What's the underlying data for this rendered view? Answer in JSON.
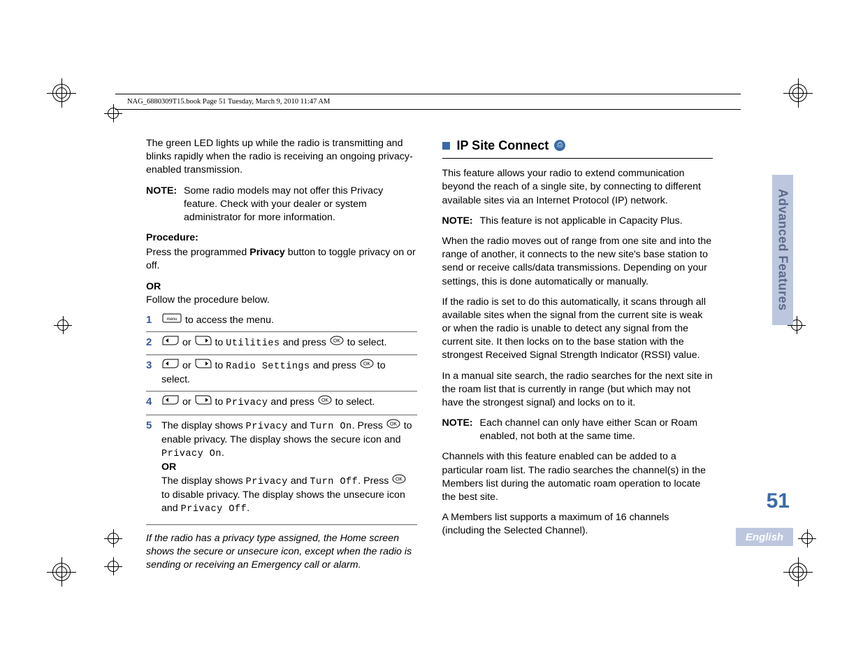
{
  "header": {
    "text": "NAG_6880309T15.book  Page 51  Tuesday, March 9, 2010  11:47 AM"
  },
  "left": {
    "p1": "The green LED lights up while the radio is transmitting and blinks rapidly when the radio is receiving an ongoing privacy-enabled transmission.",
    "note1_label": "NOTE:",
    "note1_text": "Some radio models may not offer this Privacy feature. Check with your dealer or system administrator for more information.",
    "procedure_label": "Procedure:",
    "procedure_p_a": "Press the programmed ",
    "procedure_p_b": "Privacy",
    "procedure_p_c": " button to toggle privacy on or off.",
    "or": "OR",
    "follow": "Follow the procedure below.",
    "step1": " to access the menu.",
    "step2_pre": " or ",
    "step2_to": " to ",
    "step2_target": "Utilities",
    "step2_post": " and press ",
    "step2_end": " to select.",
    "step3_target": "Radio Settings",
    "step4_target": "Privacy",
    "step5_a": "The display shows ",
    "step5_b": "Privacy",
    "step5_c": " and ",
    "step5_d": "Turn On",
    "step5_e": ". Press ",
    "step5_f": " to enable privacy. The display shows the secure icon and ",
    "step5_g": "Privacy On",
    "step5_h": ".",
    "step5_or": "OR",
    "step5_i": "The display shows ",
    "step5_j": "Privacy",
    "step5_k": " and ",
    "step5_l": "Turn Off",
    "step5_m": ". Press ",
    "step5_n": " to disable privacy. The display shows the unsecure icon and ",
    "step5_o": "Privacy Off",
    "step5_p": ".",
    "italic": "If the radio has a privacy type assigned, the Home screen shows the secure or unsecure icon, except when the radio is sending or receiving an Emergency call or alarm."
  },
  "right": {
    "heading": "IP Site Connect",
    "p1": "This feature allows your radio to extend communication beyond the reach of a single site, by connecting to different available sites via an Internet Protocol (IP) network.",
    "note1_label": "NOTE:",
    "note1_text": "This feature is not applicable in Capacity Plus.",
    "p2": "When the radio moves out of range from one site and into the range of another, it connects to the new site's base station to send or receive calls/data transmissions. Depending on your settings, this is done automatically or manually.",
    "p3": "If the radio is set to do this automatically, it scans through all available sites when the signal from the current site is weak or when the radio is unable to detect any signal from the current site. It then locks on to the base station with the strongest Received Signal Strength Indicator (RSSI) value.",
    "p4": "In a manual site search, the radio searches for the next site in the roam list that is currently in range (but which may not have the strongest signal) and locks on to it.",
    "note2_label": "NOTE:",
    "note2_text": "Each channel can only have either Scan or Roam enabled, not both at the same time.",
    "p5": "Channels with this feature enabled can be added to a particular roam list. The radio searches the channel(s) in the Members list during the automatic roam operation to locate the best site.",
    "p6": "A Members list supports a maximum of 16 channels (including the Selected Channel)."
  },
  "tab": "Advanced Features",
  "page_number": "51",
  "language": "English",
  "steps_nums": {
    "s1": "1",
    "s2": "2",
    "s3": "3",
    "s4": "4",
    "s5": "5"
  }
}
